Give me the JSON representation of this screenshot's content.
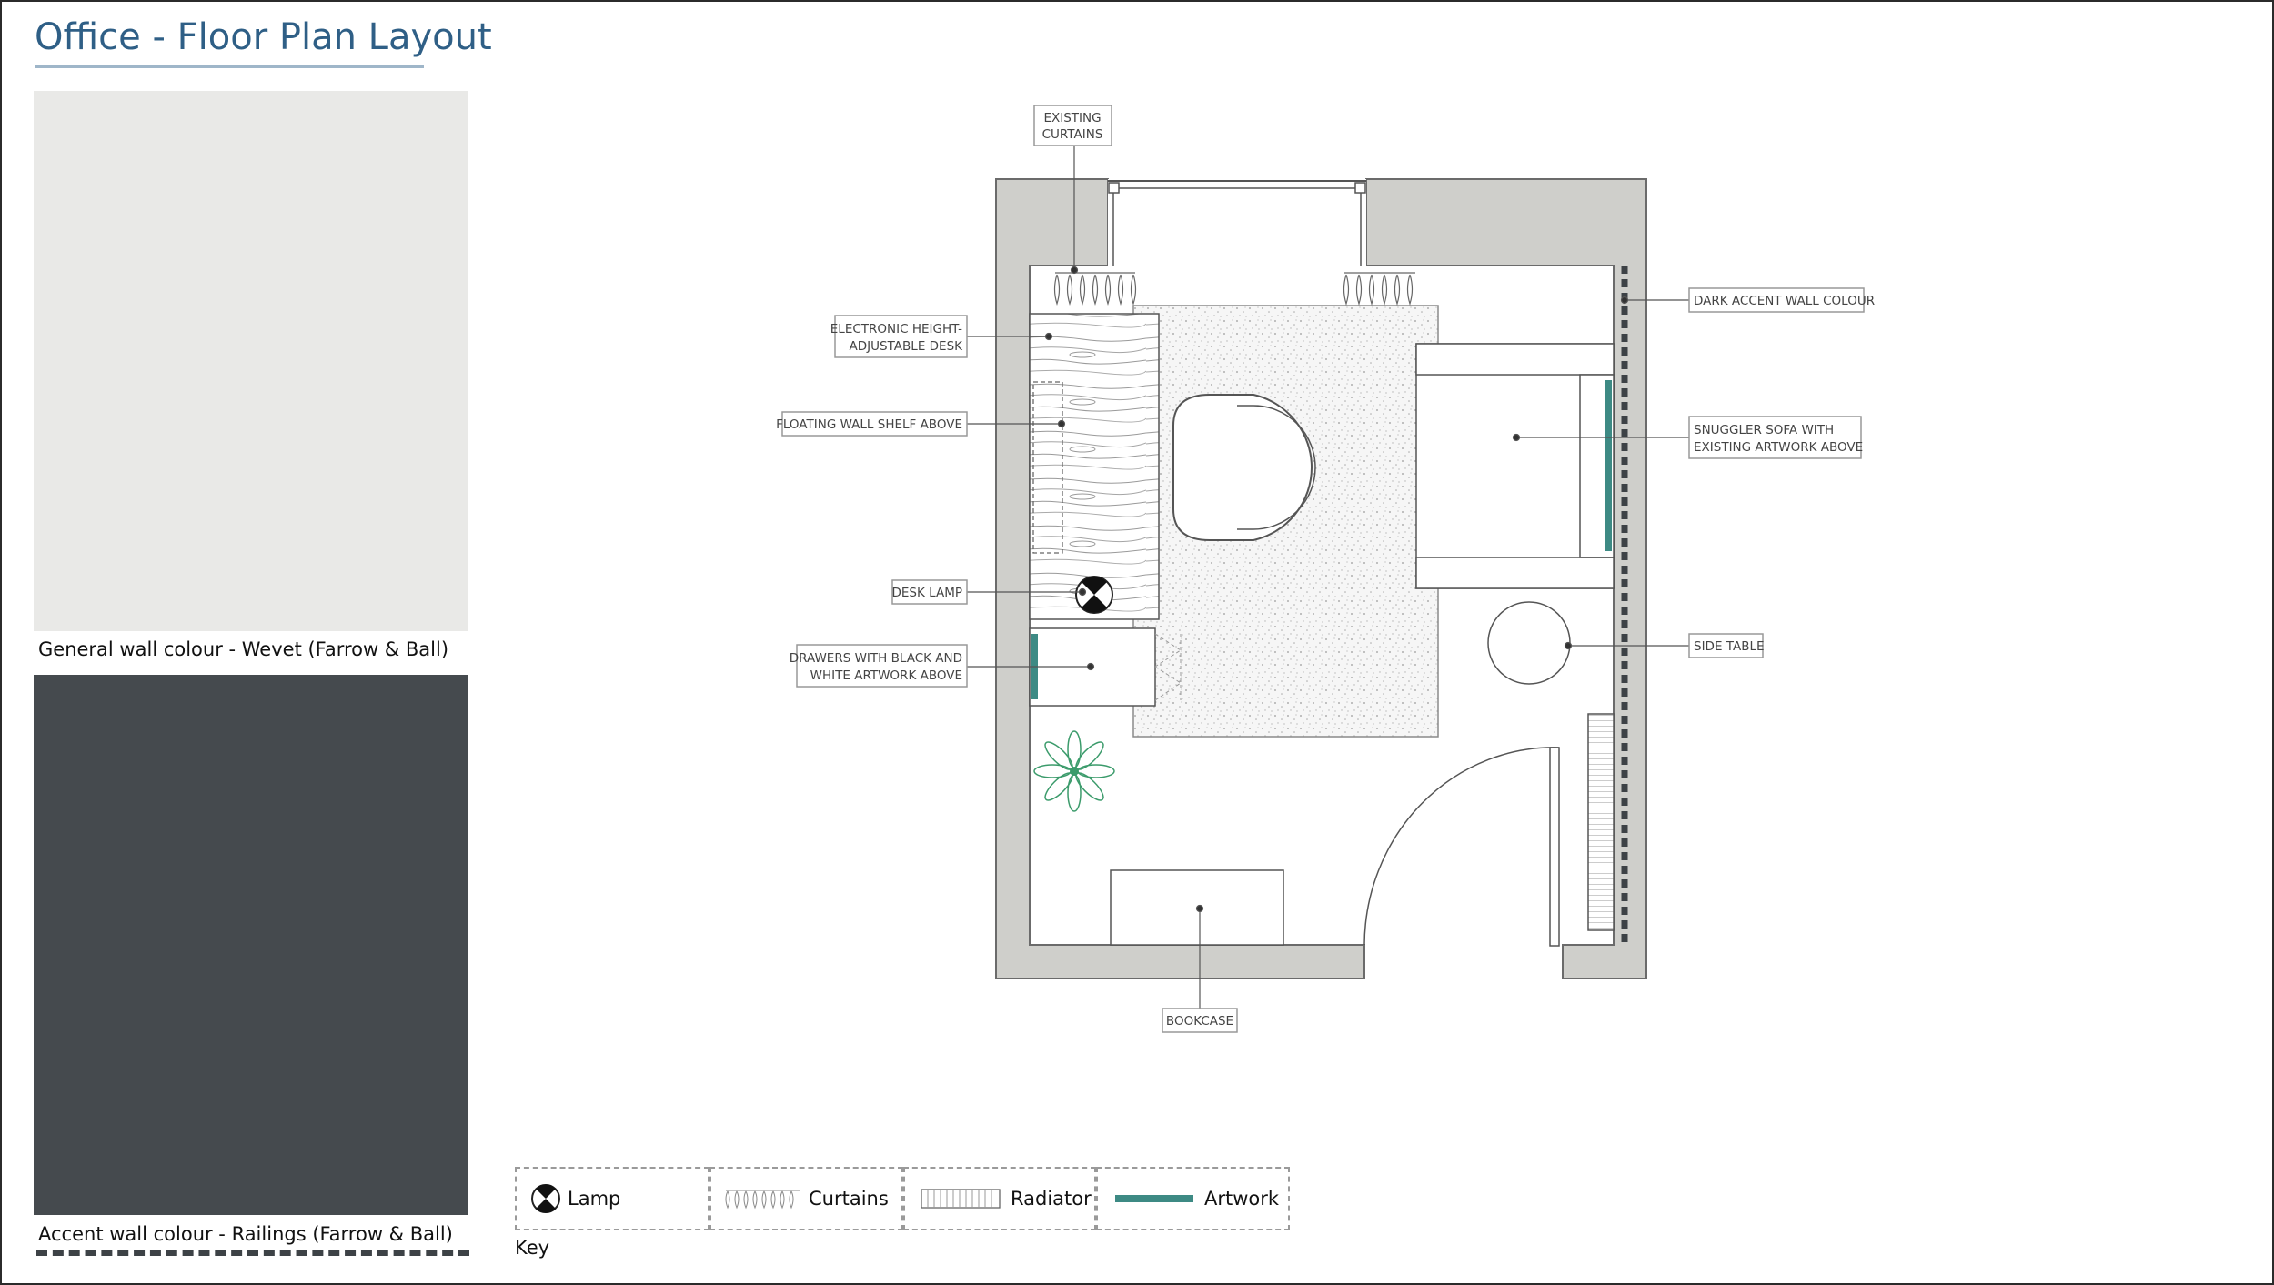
{
  "title": "Office - Floor Plan Layout",
  "swatches": {
    "general_label": "General wall colour - Wevet (Farrow & Ball)",
    "accent_label": "Accent wall colour - Railings (Farrow & Ball)",
    "general_color": "#e9e9e7",
    "accent_color": "#454a4e"
  },
  "callouts": {
    "existing_curtains": [
      "EXISTING",
      "CURTAINS"
    ],
    "desk": [
      "ELECTRONIC HEIGHT-",
      "ADJUSTABLE DESK"
    ],
    "shelf": "FLOATING WALL SHELF ABOVE",
    "desk_lamp": "DESK LAMP",
    "drawers": [
      "DRAWERS WITH BLACK AND",
      "WHITE ARTWORK ABOVE"
    ],
    "dark_accent_wall": "DARK ACCENT WALL COLOUR",
    "sofa": [
      "SNUGGLER SOFA WITH",
      "EXISTING ARTWORK ABOVE"
    ],
    "side_table": "SIDE TABLE",
    "bookcase": "BOOKCASE"
  },
  "legend": {
    "title": "Key",
    "items": [
      "Lamp",
      "Curtains",
      "Radiator",
      "Artwork"
    ]
  },
  "colors": {
    "wall_fill": "#cfcfcb",
    "artwork": "#3d8a84",
    "plant": "#3b9b6b",
    "title": "#2f5f86"
  }
}
